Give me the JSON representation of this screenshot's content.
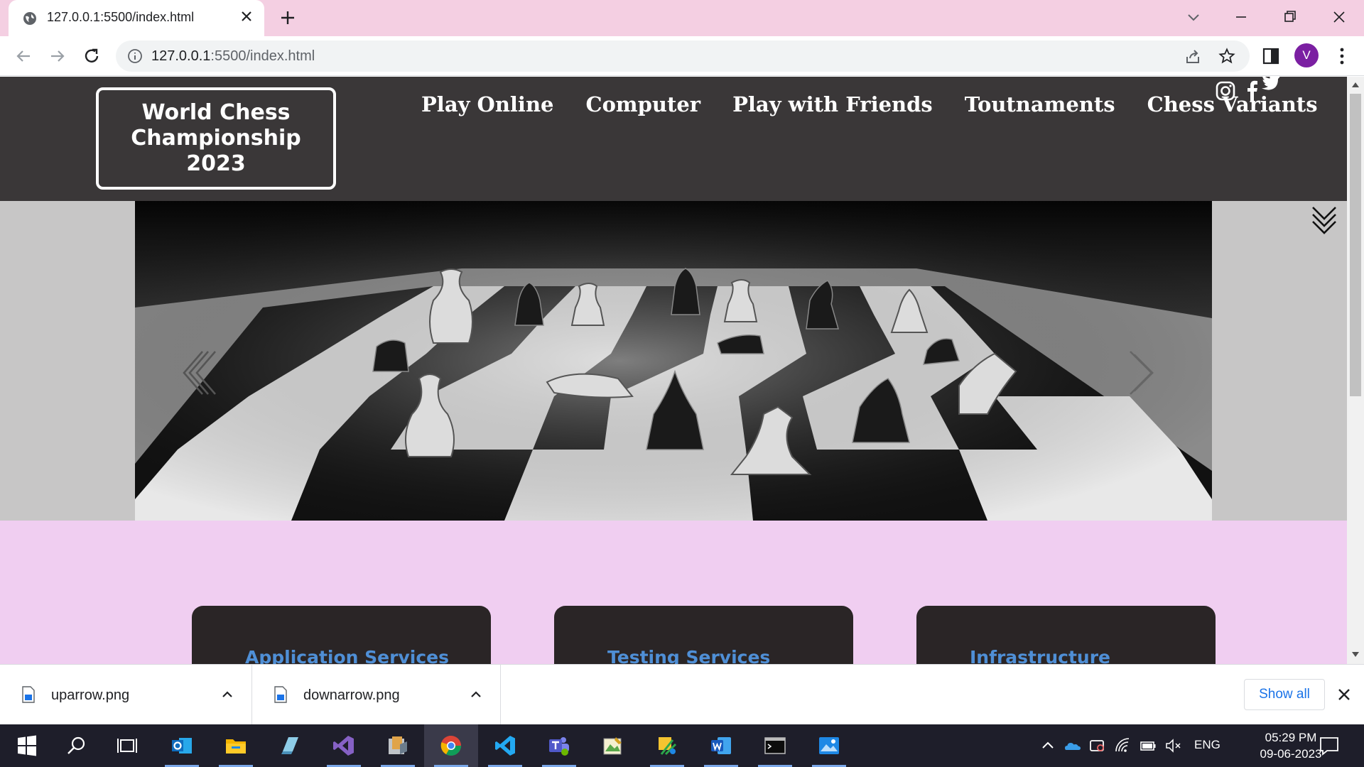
{
  "browser": {
    "tab_title": "127.0.0.1:5500/index.html",
    "url_host": "127.0.0.1",
    "url_rest": ":5500/index.html",
    "profile_initial": "V"
  },
  "site": {
    "logo_text": "World Chess Championship 2023",
    "nav": [
      "Play Online",
      "Computer",
      "Play with Friends",
      "Toutnaments",
      "Chess Variants"
    ],
    "social": [
      "instagram-icon",
      "facebook-icon",
      "twitter-icon"
    ],
    "services": [
      "Application Services",
      "Testing Services",
      "Infrastructure"
    ]
  },
  "downloads": {
    "items": [
      "uparrow.png",
      "downarrow.png"
    ],
    "show_all": "Show all"
  },
  "taskbar": {
    "apps": [
      "start",
      "search",
      "task-view",
      "outlook",
      "file-explorer",
      "notepad",
      "visual-studio",
      "ssms",
      "chrome",
      "vscode",
      "teams",
      "paint",
      "snipping-tool",
      "word",
      "terminal",
      "photos"
    ],
    "language": "ENG",
    "time": "05:29 PM",
    "date": "09-06-2023"
  },
  "colors": {
    "tab_bar": "#f4cfe2",
    "site_header": "#3a3738",
    "page_bg": "#f0cef1",
    "card_bg": "#2a2526",
    "card_title": "#4f8fd6"
  }
}
